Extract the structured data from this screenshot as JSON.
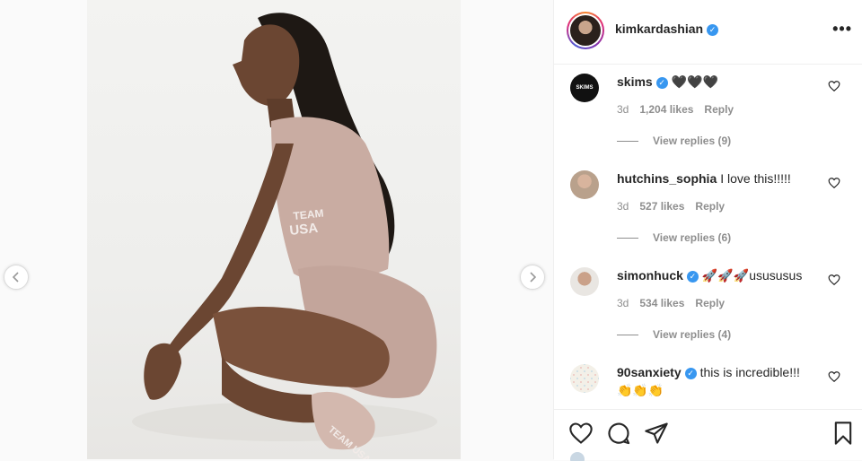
{
  "post": {
    "author": "kimkardashian",
    "author_verified": true,
    "more_label": "•••"
  },
  "photo": {
    "shirt_print": "TEAM\nUSA",
    "sock_print": "TEAM USA"
  },
  "comments": [
    {
      "user": "skims",
      "verified": true,
      "text": "🖤🖤🖤",
      "age": "3d",
      "likes": "1,204 likes",
      "reply_label": "Reply",
      "view_replies": "View replies (9)",
      "avatar_text": "SKIMS"
    },
    {
      "user": "hutchins_sophia",
      "verified": false,
      "text": "I love this!!!!!",
      "age": "3d",
      "likes": "527 likes",
      "reply_label": "Reply",
      "view_replies": "View replies (6)"
    },
    {
      "user": "simonhuck",
      "verified": true,
      "text": "🚀🚀🚀usususus",
      "age": "3d",
      "likes": "534 likes",
      "reply_label": "Reply",
      "view_replies": "View replies (4)"
    },
    {
      "user": "90sanxiety",
      "verified": true,
      "text": "this is incredible!!!",
      "text2": "👏👏👏"
    }
  ],
  "icons": {
    "prev": "chevron-left-icon",
    "next": "chevron-right-icon",
    "like": "heart-icon",
    "comment": "comment-icon",
    "share": "paper-plane-icon",
    "save": "bookmark-icon",
    "verified": "verified-badge-icon"
  },
  "colors": {
    "verified": "#3897f0",
    "text": "#262626",
    "muted": "#8e8e8e",
    "border": "#efefef"
  }
}
